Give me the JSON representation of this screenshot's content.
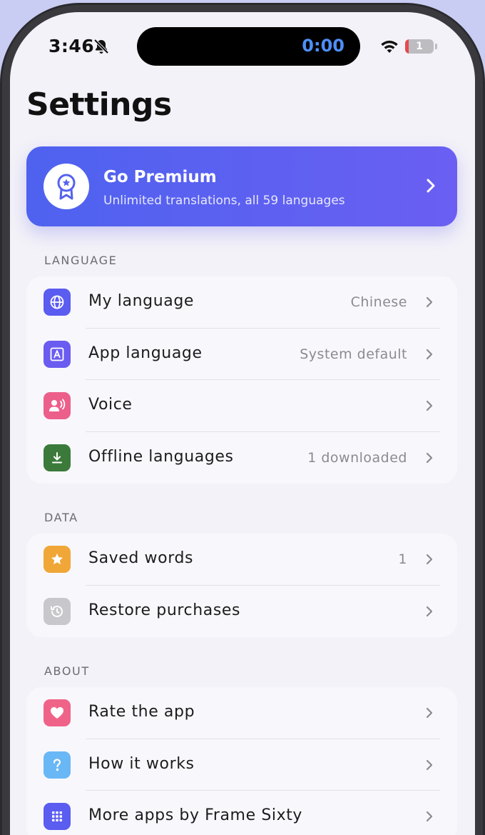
{
  "status_bar": {
    "time": "3:46",
    "timer": "0:00",
    "battery_level": "1"
  },
  "title": "Settings",
  "premium": {
    "title": "Go Premium",
    "subtitle": "Unlimited translations, all 59 languages"
  },
  "sections": {
    "language": {
      "header": "LANGUAGE",
      "rows": [
        {
          "label": "My language",
          "value": "Chinese",
          "icon": "globe-icon",
          "color": "#5b5cf0"
        },
        {
          "label": "App language",
          "value": "System default",
          "icon": "letter-a-icon",
          "color": "#6a5cf0"
        },
        {
          "label": "Voice",
          "value": "",
          "icon": "speaking-person-icon",
          "color": "#ec5f8b"
        },
        {
          "label": "Offline languages",
          "value": "1 downloaded",
          "icon": "download-icon",
          "color": "#3b7a3b"
        }
      ]
    },
    "data": {
      "header": "DATA",
      "rows": [
        {
          "label": "Saved words",
          "value": "1",
          "icon": "star-icon",
          "color": "#f0a738"
        },
        {
          "label": "Restore purchases",
          "value": "",
          "icon": "history-icon",
          "color": "#c7c7cc"
        }
      ]
    },
    "about": {
      "header": "ABOUT",
      "rows": [
        {
          "label": "Rate the app",
          "value": "",
          "icon": "heart-icon",
          "color": "#f06389"
        },
        {
          "label": "How it works",
          "value": "",
          "icon": "question-icon",
          "color": "#6ab7f5"
        },
        {
          "label": "More apps by Frame Sixty",
          "value": "",
          "icon": "grid-icon",
          "color": "#5b5cf0"
        }
      ]
    }
  }
}
